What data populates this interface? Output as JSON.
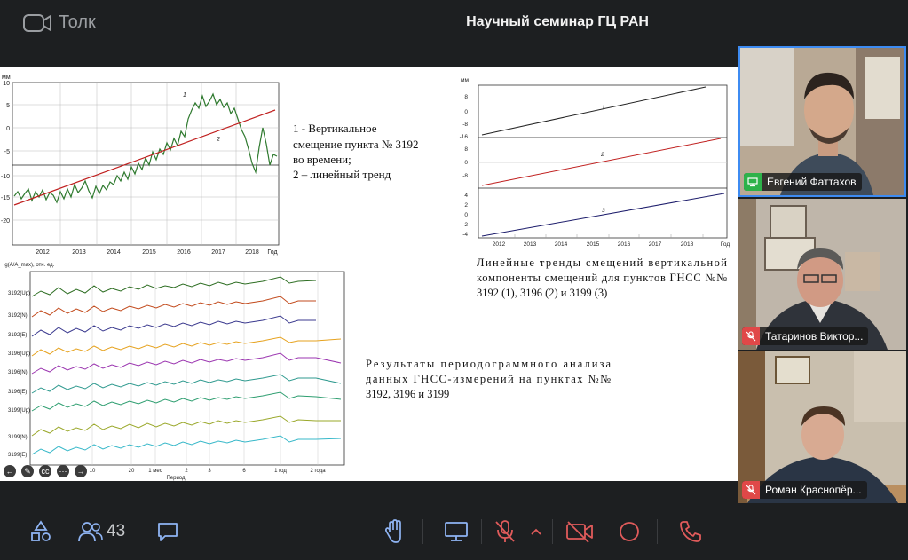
{
  "app": {
    "name": "Толк",
    "title": "Научный семинар ГЦ РАН"
  },
  "slide": {
    "chart1": {
      "unit": "мм",
      "yticks": [
        "10",
        "5",
        "0",
        "-5",
        "-10",
        "-15",
        "-20"
      ],
      "xticks": [
        "2012",
        "2013",
        "2014",
        "2015",
        "2016",
        "2017",
        "2018",
        "Год"
      ],
      "markers": [
        "1",
        "2"
      ]
    },
    "legend1": [
      "1 - Вертикальное",
      "смещение пункта № 3192",
      "во времени;",
      "2 – линейный тренд"
    ],
    "chart2": {
      "unit": "мм",
      "yticks": [
        "8",
        "0",
        "-8",
        "-16",
        "8",
        "0",
        "-8",
        "4",
        "2",
        "0",
        "-2",
        "-4"
      ],
      "xticks": [
        "2012",
        "2013",
        "2014",
        "2015",
        "2016",
        "2017",
        "2018",
        "Год"
      ],
      "labels": [
        "1",
        "2",
        "3"
      ]
    },
    "caption2": [
      "Линейные тренды смещений вертикальной",
      "компоненты смещений для пунктов ГНСС №№",
      "3192 (1), 3196 (2) и 3199 (3)"
    ],
    "chart3": {
      "ylabel": "lg(A/A_max), отн. ед.",
      "series": [
        "3192(Up)",
        "3192(N)",
        "3192(E)",
        "3196(Up)",
        "3196(N)",
        "3196(E)",
        "3199(Up)",
        "3199(N)",
        "3199(E)"
      ],
      "xticks": [
        "10",
        "20",
        "1 мес",
        "2",
        "3",
        "6",
        "1 год",
        "2 года"
      ],
      "xlabel": "Период"
    },
    "caption3": [
      "Результаты периодограммного анализа",
      "данных ГНСС-измерений на пунктах №№",
      "3192, 3196 и 3199"
    ]
  },
  "participants": [
    {
      "name": "Евгений Фаттахов",
      "status": "screen"
    },
    {
      "name": "Татаринов Виктор...",
      "status": "muted"
    },
    {
      "name": "Роман Краснопёр...",
      "status": "muted"
    }
  ],
  "controls": {
    "participants_count": "43"
  },
  "colors": {
    "accent": "#3d8bf2",
    "danger": "#e04848",
    "share": "#2db24a"
  }
}
